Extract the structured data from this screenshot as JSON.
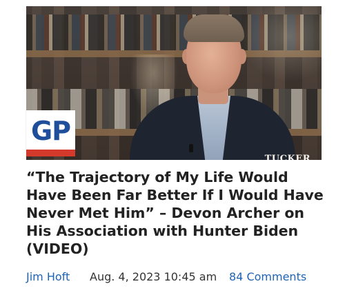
{
  "article": {
    "headline": "“The Trajectory of My Life Would Have Been Far Better If I Would Have Never Met Him” – Devon Archer on His Association with Hunter Biden (VIDEO)",
    "thumbnail": {
      "logo_text": "GP",
      "watermark": "TUCKER"
    },
    "meta": {
      "author": "Jim Hoft",
      "date": "Aug. 4, 2023 10:45 am",
      "comments": "84 Comments"
    }
  },
  "colors": {
    "link": "#1e63b6",
    "headline": "#222222",
    "logo_blue": "#1f4e9a",
    "logo_red": "#d33a2c"
  }
}
